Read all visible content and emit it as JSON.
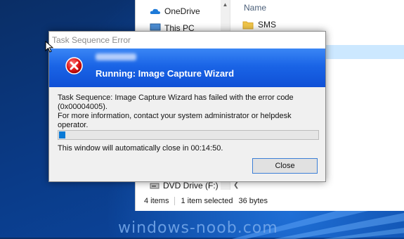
{
  "explorer": {
    "nav_items": [
      {
        "label": "OneDrive",
        "icon": "onedrive-icon"
      },
      {
        "label": "This PC",
        "icon": "this-pc-icon"
      },
      {
        "label": "DVD Drive (F:) C",
        "icon": "dvd-drive-icon"
      }
    ],
    "column_name": "Name",
    "files": [
      {
        "name": "SMS",
        "icon": "folder-icon"
      }
    ],
    "status": {
      "items": "4 items",
      "selected": "1 item selected",
      "size": "36 bytes"
    },
    "selection_color": "#cce8ff"
  },
  "dialog": {
    "window_title": "Task Sequence Error",
    "heading": "Running: Image Capture Wizard",
    "message_line1": "Task Sequence: Image Capture Wizard has failed with the error code  (0x00004005).",
    "message_line2": "For more information, contact your system administrator or helpdesk operator.",
    "progress_fraction": 0.015,
    "countdown": "This window will automatically close in 00:14:50.",
    "close_label": "Close",
    "banner_color": "#1a64e6",
    "icon": "error-icon"
  },
  "watermark": "windows-noob.com"
}
